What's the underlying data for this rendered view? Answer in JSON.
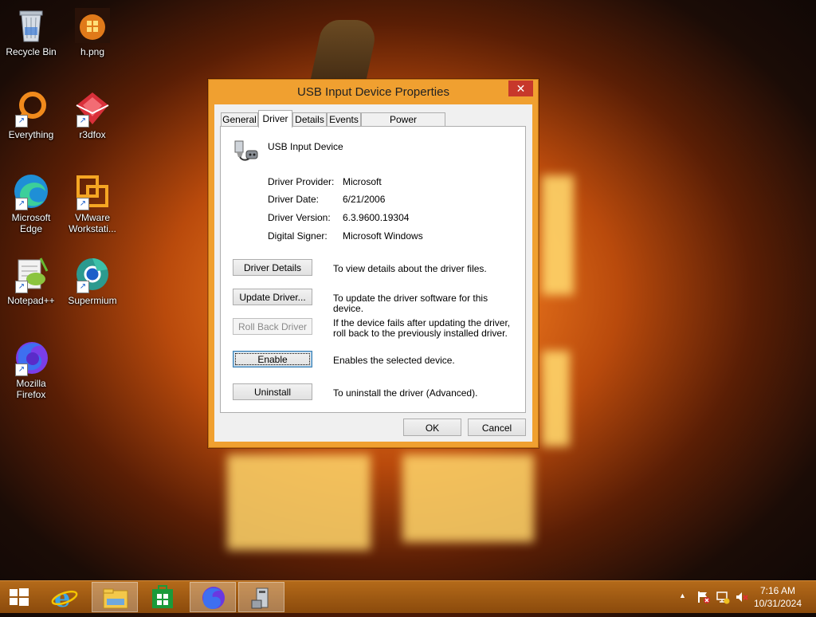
{
  "desktop": {
    "icons": [
      {
        "label": "Recycle Bin"
      },
      {
        "label": "h.png"
      },
      {
        "label": "Everything"
      },
      {
        "label": "r3dfox"
      },
      {
        "label": "Microsoft Edge"
      },
      {
        "label": "VMware Workstati..."
      },
      {
        "label": "Notepad++"
      },
      {
        "label": "Supermium"
      },
      {
        "label": "Mozilla Firefox"
      }
    ]
  },
  "dialog": {
    "title": "USB Input Device Properties",
    "close_glyph": "✕",
    "tabs": [
      "General",
      "Driver",
      "Details",
      "Events",
      "Power Management"
    ],
    "active_tab": "Driver",
    "device_name": "USB Input Device",
    "fields": [
      {
        "label": "Driver Provider:",
        "value": "Microsoft"
      },
      {
        "label": "Driver Date:",
        "value": "6/21/2006"
      },
      {
        "label": "Driver Version:",
        "value": "6.3.9600.19304"
      },
      {
        "label": "Digital Signer:",
        "value": "Microsoft Windows"
      }
    ],
    "actions": [
      {
        "button": "Driver Details",
        "description": "To view details about the driver files."
      },
      {
        "button": "Update Driver...",
        "description": "To update the driver software for this device."
      },
      {
        "button": "Roll Back Driver",
        "description": "If the device fails after updating the driver, roll back to the previously installed driver."
      },
      {
        "button": "Enable",
        "description": "Enables the selected device."
      },
      {
        "button": "Uninstall",
        "description": "To uninstall the driver (Advanced)."
      }
    ],
    "ok_label": "OK",
    "cancel_label": "Cancel"
  },
  "taskbar": {
    "tray_arrow": "▲",
    "time": "7:16 AM",
    "date": "10/31/2024"
  },
  "colors": {
    "accent": "#f0a030",
    "close": "#c7382b",
    "taskbar": "#9a560f"
  }
}
